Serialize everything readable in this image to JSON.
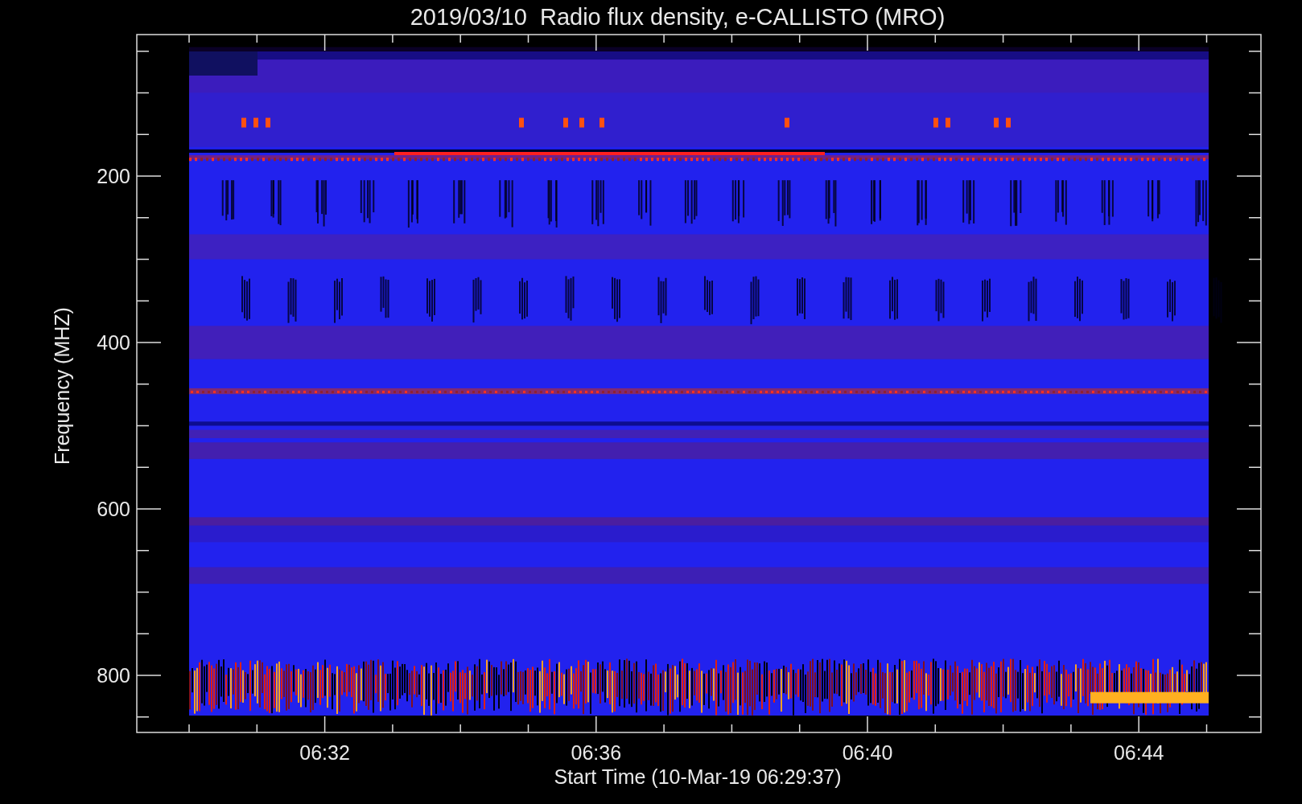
{
  "title": "2019/03/10  Radio flux density, e-CALLISTO (MRO)",
  "y_axis": {
    "label": "Frequency (MHZ)",
    "ticks": [
      "200",
      "400",
      "600",
      "800"
    ]
  },
  "x_axis": {
    "label": "Start Time (10-Mar-19 06:29:37)",
    "ticks": [
      "06:32",
      "06:36",
      "06:40",
      "06:44"
    ]
  }
}
